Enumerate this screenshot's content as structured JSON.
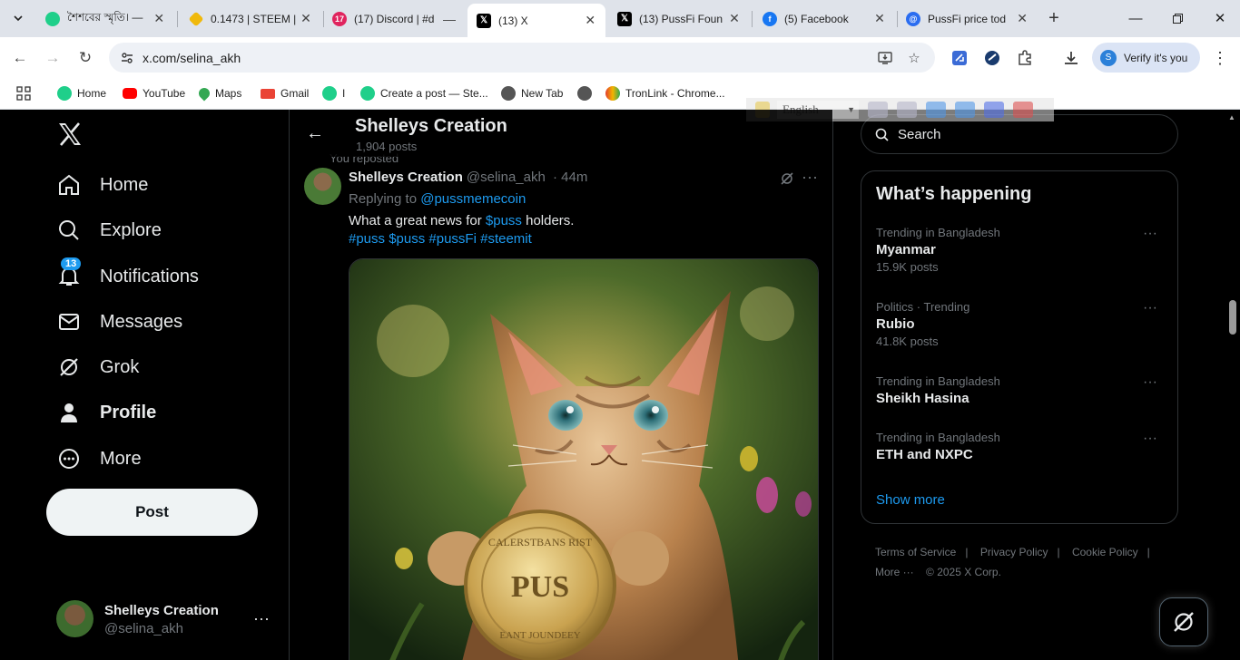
{
  "browser": {
    "tabs": [
      {
        "title": "শৈশবের স্মৃতি। —",
        "favicon_color": "#1fcf8a",
        "active": false
      },
      {
        "title": "0.1473 | STEEM |",
        "favicon_color": "#f0b90b",
        "active": false
      },
      {
        "title": "(17) Discord | #d",
        "favicon_color": "#e0245e",
        "active": false
      },
      {
        "title": "(13) X",
        "favicon_color": "#000000",
        "active": true
      },
      {
        "title": "(13) PussFi Foun",
        "favicon_color": "#000000",
        "active": false
      },
      {
        "title": "(5) Facebook",
        "favicon_color": "#1877f2",
        "active": false
      },
      {
        "title": "PussFi price tod",
        "favicon_color": "#2b6df0",
        "active": false
      }
    ],
    "discord_badge": "17",
    "url": "x.com/selina_akh",
    "verify_label": "Verify it's you",
    "bookmarks": [
      {
        "label": "Home",
        "color": "#1fcf8a"
      },
      {
        "label": "YouTube",
        "color": "#ff0000"
      },
      {
        "label": "Maps",
        "color": "#34a853"
      },
      {
        "label": "Gmail",
        "color": "#ea4335"
      },
      {
        "label": "I",
        "color": "#1fcf8a"
      },
      {
        "label": "Create a post — Ste...",
        "color": "#1fcf8a"
      },
      {
        "label": "New Tab",
        "color": "#555555"
      },
      {
        "label": "",
        "color": "#555555"
      },
      {
        "label": "TronLink - Chrome...",
        "color": "#e23d2d"
      }
    ],
    "translate_language": "English"
  },
  "nav": {
    "items": [
      {
        "label": "Home",
        "icon": "home-icon"
      },
      {
        "label": "Explore",
        "icon": "search-icon"
      },
      {
        "label": "Notifications",
        "icon": "bell-icon"
      },
      {
        "label": "Messages",
        "icon": "envelope-icon"
      },
      {
        "label": "Grok",
        "icon": "grok-icon"
      },
      {
        "label": "Profile",
        "icon": "person-icon"
      },
      {
        "label": "More",
        "icon": "more-circle-icon"
      }
    ],
    "notifications_badge": "13",
    "post_label": "Post",
    "account": {
      "name": "Shelleys Creation",
      "handle": "@selina_akh"
    }
  },
  "profile_header": {
    "title": "Shelleys Creation",
    "posts_count": "1,904 posts"
  },
  "tweet": {
    "context": "You reposted",
    "author": "Shelleys Creation",
    "handle": "@selina_akh",
    "time": "· 44m",
    "replying_prefix": "Replying to",
    "replying_to": "@pussmemecoin",
    "text_before": "What a great news for",
    "text_link": "$puss",
    "text_after": "holders.",
    "hashtags": [
      "#puss",
      "$puss",
      "#pussFi",
      "#steemit"
    ],
    "coin_text_top": "CALERSTBANS RIST",
    "coin_text_center": "PUS",
    "coin_text_bottom": "EANT JOUNDEEY"
  },
  "sidebar": {
    "search_placeholder": "Search",
    "happening_title": "What’s happening",
    "trends": [
      {
        "context": "Trending in Bangladesh",
        "name": "Myanmar",
        "count": "15.9K posts"
      },
      {
        "context": "Politics · Trending",
        "name": "Rubio",
        "count": "41.8K posts"
      },
      {
        "context": "Trending in Bangladesh",
        "name": "Sheikh Hasina",
        "count": ""
      },
      {
        "context": "Trending in Bangladesh",
        "name": "ETH and NXPC",
        "count": ""
      }
    ],
    "show_more": "Show more",
    "footer": {
      "terms": "Terms of Service",
      "privacy": "Privacy Policy",
      "cookie": "Cookie Policy",
      "more": "More ···",
      "copyright": "© 2025 X Corp."
    }
  }
}
